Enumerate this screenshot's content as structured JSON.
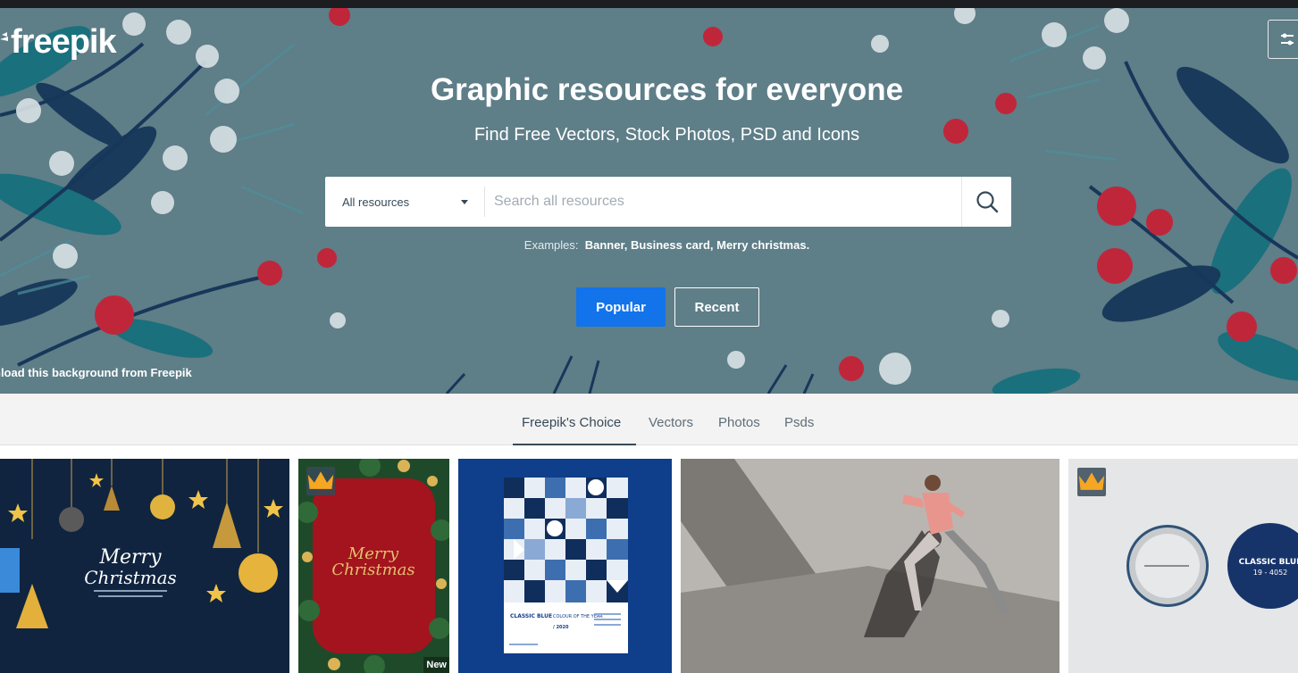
{
  "brand": {
    "name": "freepik"
  },
  "hero": {
    "title": "Graphic resources for everyone",
    "subtitle": "Find Free Vectors, Stock Photos, PSD and Icons",
    "search": {
      "category": "All resources",
      "placeholder": "Search all resources",
      "value": ""
    },
    "examples_label": "Examples:",
    "examples_value": "Banner, Business card, Merry christmas.",
    "buttons": {
      "popular": "Popular",
      "recent": "Recent"
    },
    "background_credit": "nload this background from Freepik"
  },
  "tabs": [
    {
      "label": "Freepik's Choice",
      "active": true
    },
    {
      "label": "Vectors",
      "active": false
    },
    {
      "label": "Photos",
      "active": false
    },
    {
      "label": "Psds",
      "active": false
    }
  ],
  "gallery": [
    {
      "kind": "merry-christmas-navy",
      "text_line1": "Merry",
      "text_line2": "Christmas",
      "premium": false
    },
    {
      "kind": "merry-christmas-red",
      "text_line1": "Merry",
      "text_line2": "Christmas",
      "premium": true,
      "badge": "New"
    },
    {
      "kind": "classic-blue-geometric",
      "text": "CLASSIC BLUE",
      "text2": "COLOUR OF THE YEAR",
      "year": "/ 2020",
      "premium": false
    },
    {
      "kind": "runner-photo",
      "premium": false
    },
    {
      "kind": "pin-buttons-mockup",
      "text": "CLASSIC BLUE",
      "code": "19 - 4052",
      "premium": true
    }
  ],
  "colors": {
    "hero_bg": "#5e7e88",
    "accent_blue": "#1273eb",
    "text_dark": "#374957",
    "berry_red": "#c0263a",
    "leaf_teal": "#17707d",
    "leaf_navy": "#17375a"
  },
  "icons": {
    "search": "search-icon",
    "menu": "sliders-icon",
    "premium": "crown-icon",
    "dropdown": "caret-down-icon"
  }
}
